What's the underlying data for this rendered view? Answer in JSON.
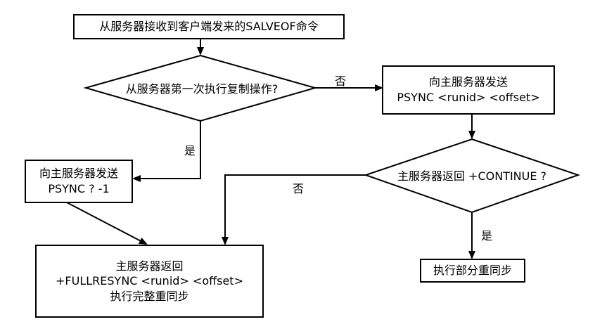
{
  "nodes": {
    "start": {
      "text": "从服务器接收到客户端发来的SALVEOF命令"
    },
    "first_sync": {
      "text": "从服务器第一次执行复制操作?"
    },
    "send_psync_id": {
      "line1": "向主服务器发送",
      "line2": "PSYNC <runid> <offset>"
    },
    "send_psync_full": {
      "line1": "向主服务器发送",
      "line2": "PSYNC ? -1"
    },
    "continue_check": {
      "text": "主服务器返回 +CONTINUE ?"
    },
    "partial_sync": {
      "text": "执行部分重同步"
    },
    "full_sync": {
      "line1": "主服务器返回",
      "line2": "+FULLRESYNC <runid> <offset>",
      "line3": "执行完整重同步"
    }
  },
  "edges": {
    "first_sync_no": "否",
    "first_sync_yes": "是",
    "continue_no": "否",
    "continue_yes": "是"
  }
}
